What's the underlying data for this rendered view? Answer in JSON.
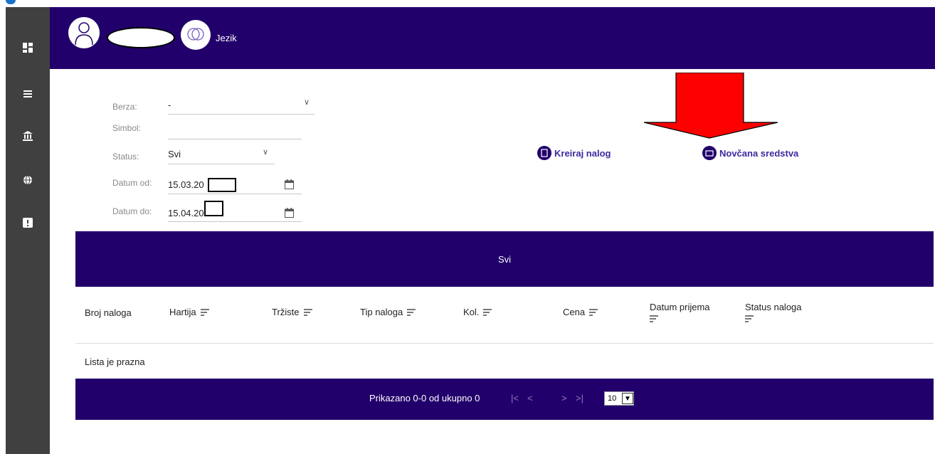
{
  "header": {
    "language_label": "Jezik"
  },
  "filters": {
    "berza": {
      "label": "Berza:",
      "value": "-"
    },
    "simbol": {
      "label": "Simbol:",
      "value": ""
    },
    "status": {
      "label": "Status:",
      "value": "Svi"
    },
    "datum_od": {
      "label": "Datum od:",
      "value": "15.03.20"
    },
    "datum_do": {
      "label": "Datum do:",
      "value": "15.04.2022"
    }
  },
  "actions": {
    "create_order": "Kreiraj nalog",
    "funds": "Novčana sredstva"
  },
  "tabs": {
    "active": "Svi"
  },
  "table": {
    "columns": [
      "Broj naloga",
      "Hartija",
      "Tržiste",
      "Tip naloga",
      "Kol.",
      "Cena",
      "Datum prijema",
      "Status naloga"
    ],
    "empty_text": "Lista je prazna"
  },
  "pagination": {
    "info": "Prikazano 0-0 od ukupno 0",
    "first": "|<",
    "prev": "<",
    "next": ">",
    "last": ">|",
    "page_size": "10"
  },
  "colors": {
    "primary": "#22006b",
    "sidebar": "#404040",
    "arrow": "#ff0000"
  }
}
